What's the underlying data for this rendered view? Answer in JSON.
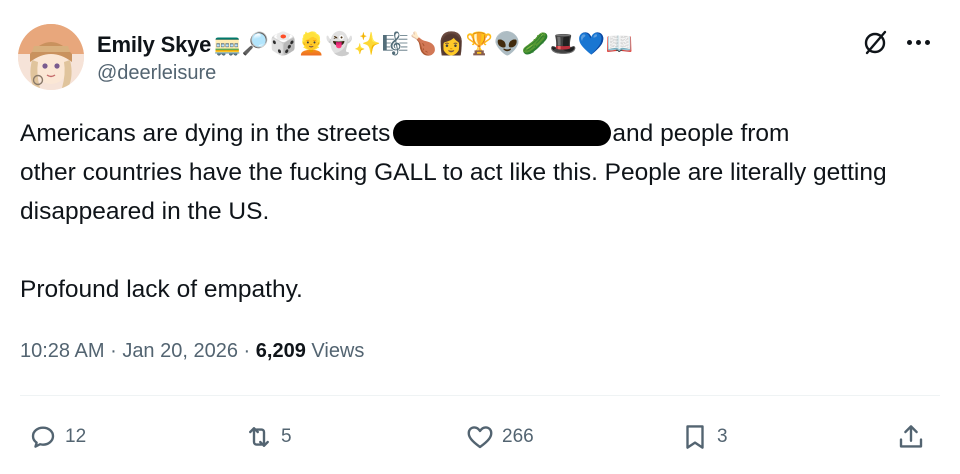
{
  "user": {
    "display_name": "Emily Skye",
    "handle": "@deerleisure",
    "name_emojis": [
      "🚃",
      "🔎",
      "🎲",
      "👱",
      "👻",
      "✨",
      "🎼",
      "🍗",
      "👩",
      "🏆",
      "👽",
      "🥒",
      "🎩",
      "💙",
      "📖"
    ]
  },
  "tweet": {
    "line1_before": "Americans are dying in the streets",
    "line1_after": "and people from",
    "body_rest": "other countries have the fucking GALL to act like this. People are literally getting disappeared in the US.",
    "paragraph2": "Profound lack of empathy."
  },
  "meta": {
    "time": "10:28 AM",
    "separator": "·",
    "date": "Jan 20, 2026",
    "views_count": "6,209",
    "views_label": "Views"
  },
  "actions": {
    "replies": "12",
    "reposts": "5",
    "likes": "266",
    "bookmarks": "3"
  },
  "icons": {
    "grok": "grok-slash-icon",
    "more": "more-icon",
    "reply": "reply-icon",
    "repost": "repost-icon",
    "like": "heart-icon",
    "bookmark": "bookmark-icon",
    "share": "share-icon"
  },
  "colors": {
    "text": "#0f1419",
    "secondary": "#536471",
    "divider": "#eff3f4"
  }
}
